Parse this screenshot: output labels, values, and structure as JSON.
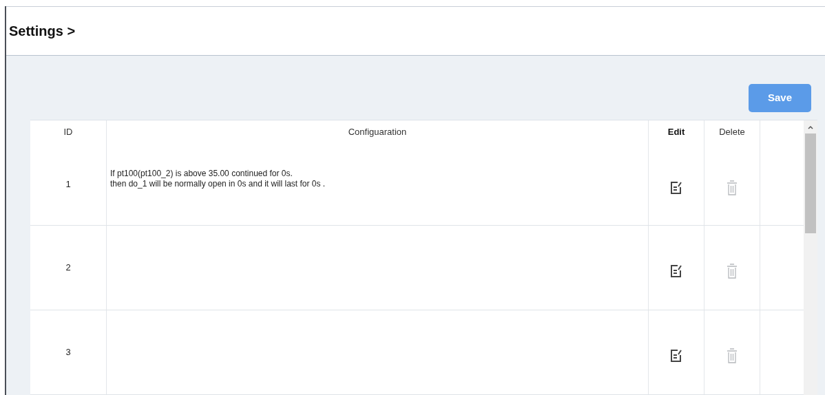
{
  "header": {
    "title": "Settings >"
  },
  "save_button": {
    "label": "Save"
  },
  "table": {
    "columns": [
      "ID",
      "Configuaration",
      "Edit",
      "Delete"
    ],
    "rows": [
      {
        "id": "1",
        "configuration": [
          "If pt100(pt100_2) is above 35.00 continued for 0s.",
          "then do_1 will be normally open in 0s and it will last for 0s ."
        ]
      },
      {
        "id": "2"
      },
      {
        "id": "3"
      }
    ]
  }
}
